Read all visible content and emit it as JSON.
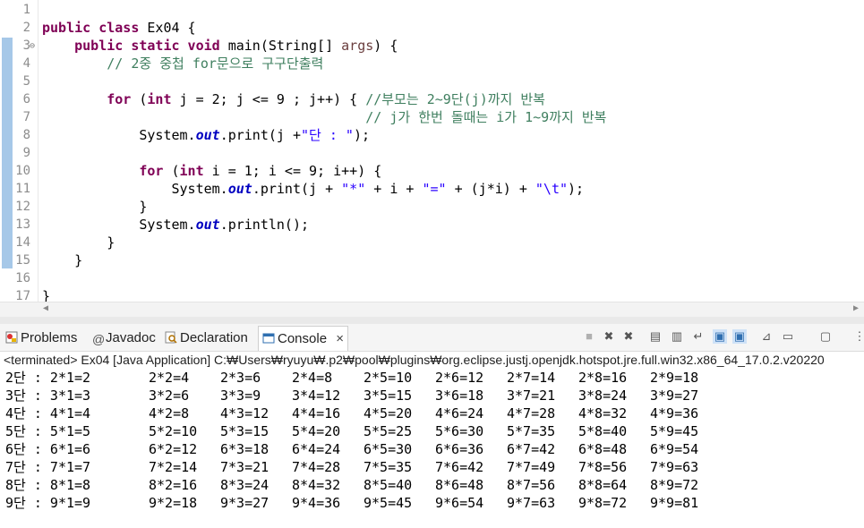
{
  "editor": {
    "line_numbers": [
      "1",
      "2",
      "3",
      "4",
      "5",
      "6",
      "7",
      "8",
      "9",
      "10",
      "11",
      "12",
      "13",
      "14",
      "15",
      "16",
      "17"
    ],
    "fold_marker": "⊖",
    "lines": [
      [],
      [
        {
          "t": "public class",
          "c": "kw"
        },
        {
          "t": " Ex04 {",
          "c": ""
        }
      ],
      [
        {
          "t": "    ",
          "c": ""
        },
        {
          "t": "public static void",
          "c": "kw"
        },
        {
          "t": " main(String[] ",
          "c": ""
        },
        {
          "t": "args",
          "c": "pa"
        },
        {
          "t": ") {",
          "c": ""
        }
      ],
      [
        {
          "t": "        // 2중 중첩 for문으로 구구단출력",
          "c": "cm"
        }
      ],
      [],
      [
        {
          "t": "        ",
          "c": ""
        },
        {
          "t": "for",
          "c": "kw"
        },
        {
          "t": " (",
          "c": ""
        },
        {
          "t": "int",
          "c": "kw"
        },
        {
          "t": " j = 2; j <= 9 ; j++) { ",
          "c": ""
        },
        {
          "t": "//부모는 2~9단(j)까지 반복",
          "c": "cm"
        }
      ],
      [
        {
          "t": "                                        ",
          "c": ""
        },
        {
          "t": "// j가 한번 돌때는 i가 1~9까지 반복",
          "c": "cm"
        }
      ],
      [
        {
          "t": "            System.",
          "c": ""
        },
        {
          "t": "out",
          "c": "fi"
        },
        {
          "t": ".print(j +",
          "c": ""
        },
        {
          "t": "\"단 : \"",
          "c": "st"
        },
        {
          "t": ");",
          "c": ""
        }
      ],
      [],
      [
        {
          "t": "            ",
          "c": ""
        },
        {
          "t": "for",
          "c": "kw"
        },
        {
          "t": " (",
          "c": ""
        },
        {
          "t": "int",
          "c": "kw"
        },
        {
          "t": " i = 1; i <= 9; i++) {",
          "c": ""
        }
      ],
      [
        {
          "t": "                System.",
          "c": ""
        },
        {
          "t": "out",
          "c": "fi"
        },
        {
          "t": ".print(j + ",
          "c": ""
        },
        {
          "t": "\"*\"",
          "c": "st"
        },
        {
          "t": " + i + ",
          "c": ""
        },
        {
          "t": "\"=\"",
          "c": "st"
        },
        {
          "t": " + (j*i) + ",
          "c": ""
        },
        {
          "t": "\"\\t\"",
          "c": "st"
        },
        {
          "t": ");",
          "c": ""
        }
      ],
      [
        {
          "t": "            }",
          "c": ""
        }
      ],
      [
        {
          "t": "            System.",
          "c": ""
        },
        {
          "t": "out",
          "c": "fi"
        },
        {
          "t": ".println();",
          "c": ""
        }
      ],
      [
        {
          "t": "        }",
          "c": ""
        }
      ],
      [
        {
          "t": "    }",
          "c": ""
        }
      ],
      [],
      [
        {
          "t": "}",
          "c": ""
        }
      ]
    ]
  },
  "tabs": [
    {
      "label": "Problems",
      "icon": "problems-icon"
    },
    {
      "label": "Javadoc",
      "icon": "javadoc-icon"
    },
    {
      "label": "Declaration",
      "icon": "declaration-icon"
    },
    {
      "label": "Console",
      "icon": "console-icon",
      "active": true,
      "close": "×"
    }
  ],
  "toolbar_icons": [
    "terminate-icon",
    "remove-launch-icon",
    "remove-all-icon",
    "clear-console-icon",
    "scroll-lock-icon",
    "word-wrap-icon",
    "show-stdout-icon",
    "show-stderr-icon",
    "pin-console-icon",
    "display-console-icon",
    "open-console-icon",
    "view-menu-icon"
  ],
  "console": {
    "terminated_line": "<terminated> Ex04 [Java Application] C:₩Users₩ryuyu₩.p2₩pool₩plugins₩org.eclipse.justj.openjdk.hotspot.jre.full.win32.x86_64_17.0.2.v20220",
    "rows": [
      [
        "2단 : 2*1=2",
        "2*2=4",
        "2*3=6",
        "2*4=8",
        "2*5=10",
        "2*6=12",
        "2*7=14",
        "2*8=16",
        "2*9=18"
      ],
      [
        "3단 : 3*1=3",
        "3*2=6",
        "3*3=9",
        "3*4=12",
        "3*5=15",
        "3*6=18",
        "3*7=21",
        "3*8=24",
        "3*9=27"
      ],
      [
        "4단 : 4*1=4",
        "4*2=8",
        "4*3=12",
        "4*4=16",
        "4*5=20",
        "4*6=24",
        "4*7=28",
        "4*8=32",
        "4*9=36"
      ],
      [
        "5단 : 5*1=5",
        "5*2=10",
        "5*3=15",
        "5*4=20",
        "5*5=25",
        "5*6=30",
        "5*7=35",
        "5*8=40",
        "5*9=45"
      ],
      [
        "6단 : 6*1=6",
        "6*2=12",
        "6*3=18",
        "6*4=24",
        "6*5=30",
        "6*6=36",
        "6*7=42",
        "6*8=48",
        "6*9=54"
      ],
      [
        "7단 : 7*1=7",
        "7*2=14",
        "7*3=21",
        "7*4=28",
        "7*5=35",
        "7*6=42",
        "7*7=49",
        "7*8=56",
        "7*9=63"
      ],
      [
        "8단 : 8*1=8",
        "8*2=16",
        "8*3=24",
        "8*4=32",
        "8*5=40",
        "8*6=48",
        "8*7=56",
        "8*8=64",
        "8*9=72"
      ],
      [
        "9단 : 9*1=9",
        "9*2=18",
        "9*3=27",
        "9*4=36",
        "9*5=45",
        "9*6=54",
        "9*7=63",
        "9*8=72",
        "9*9=81"
      ]
    ]
  },
  "colors": {
    "keyword": "#7f0055",
    "comment": "#3f7f5f",
    "string": "#2a00ff",
    "field": "#0000c0"
  }
}
